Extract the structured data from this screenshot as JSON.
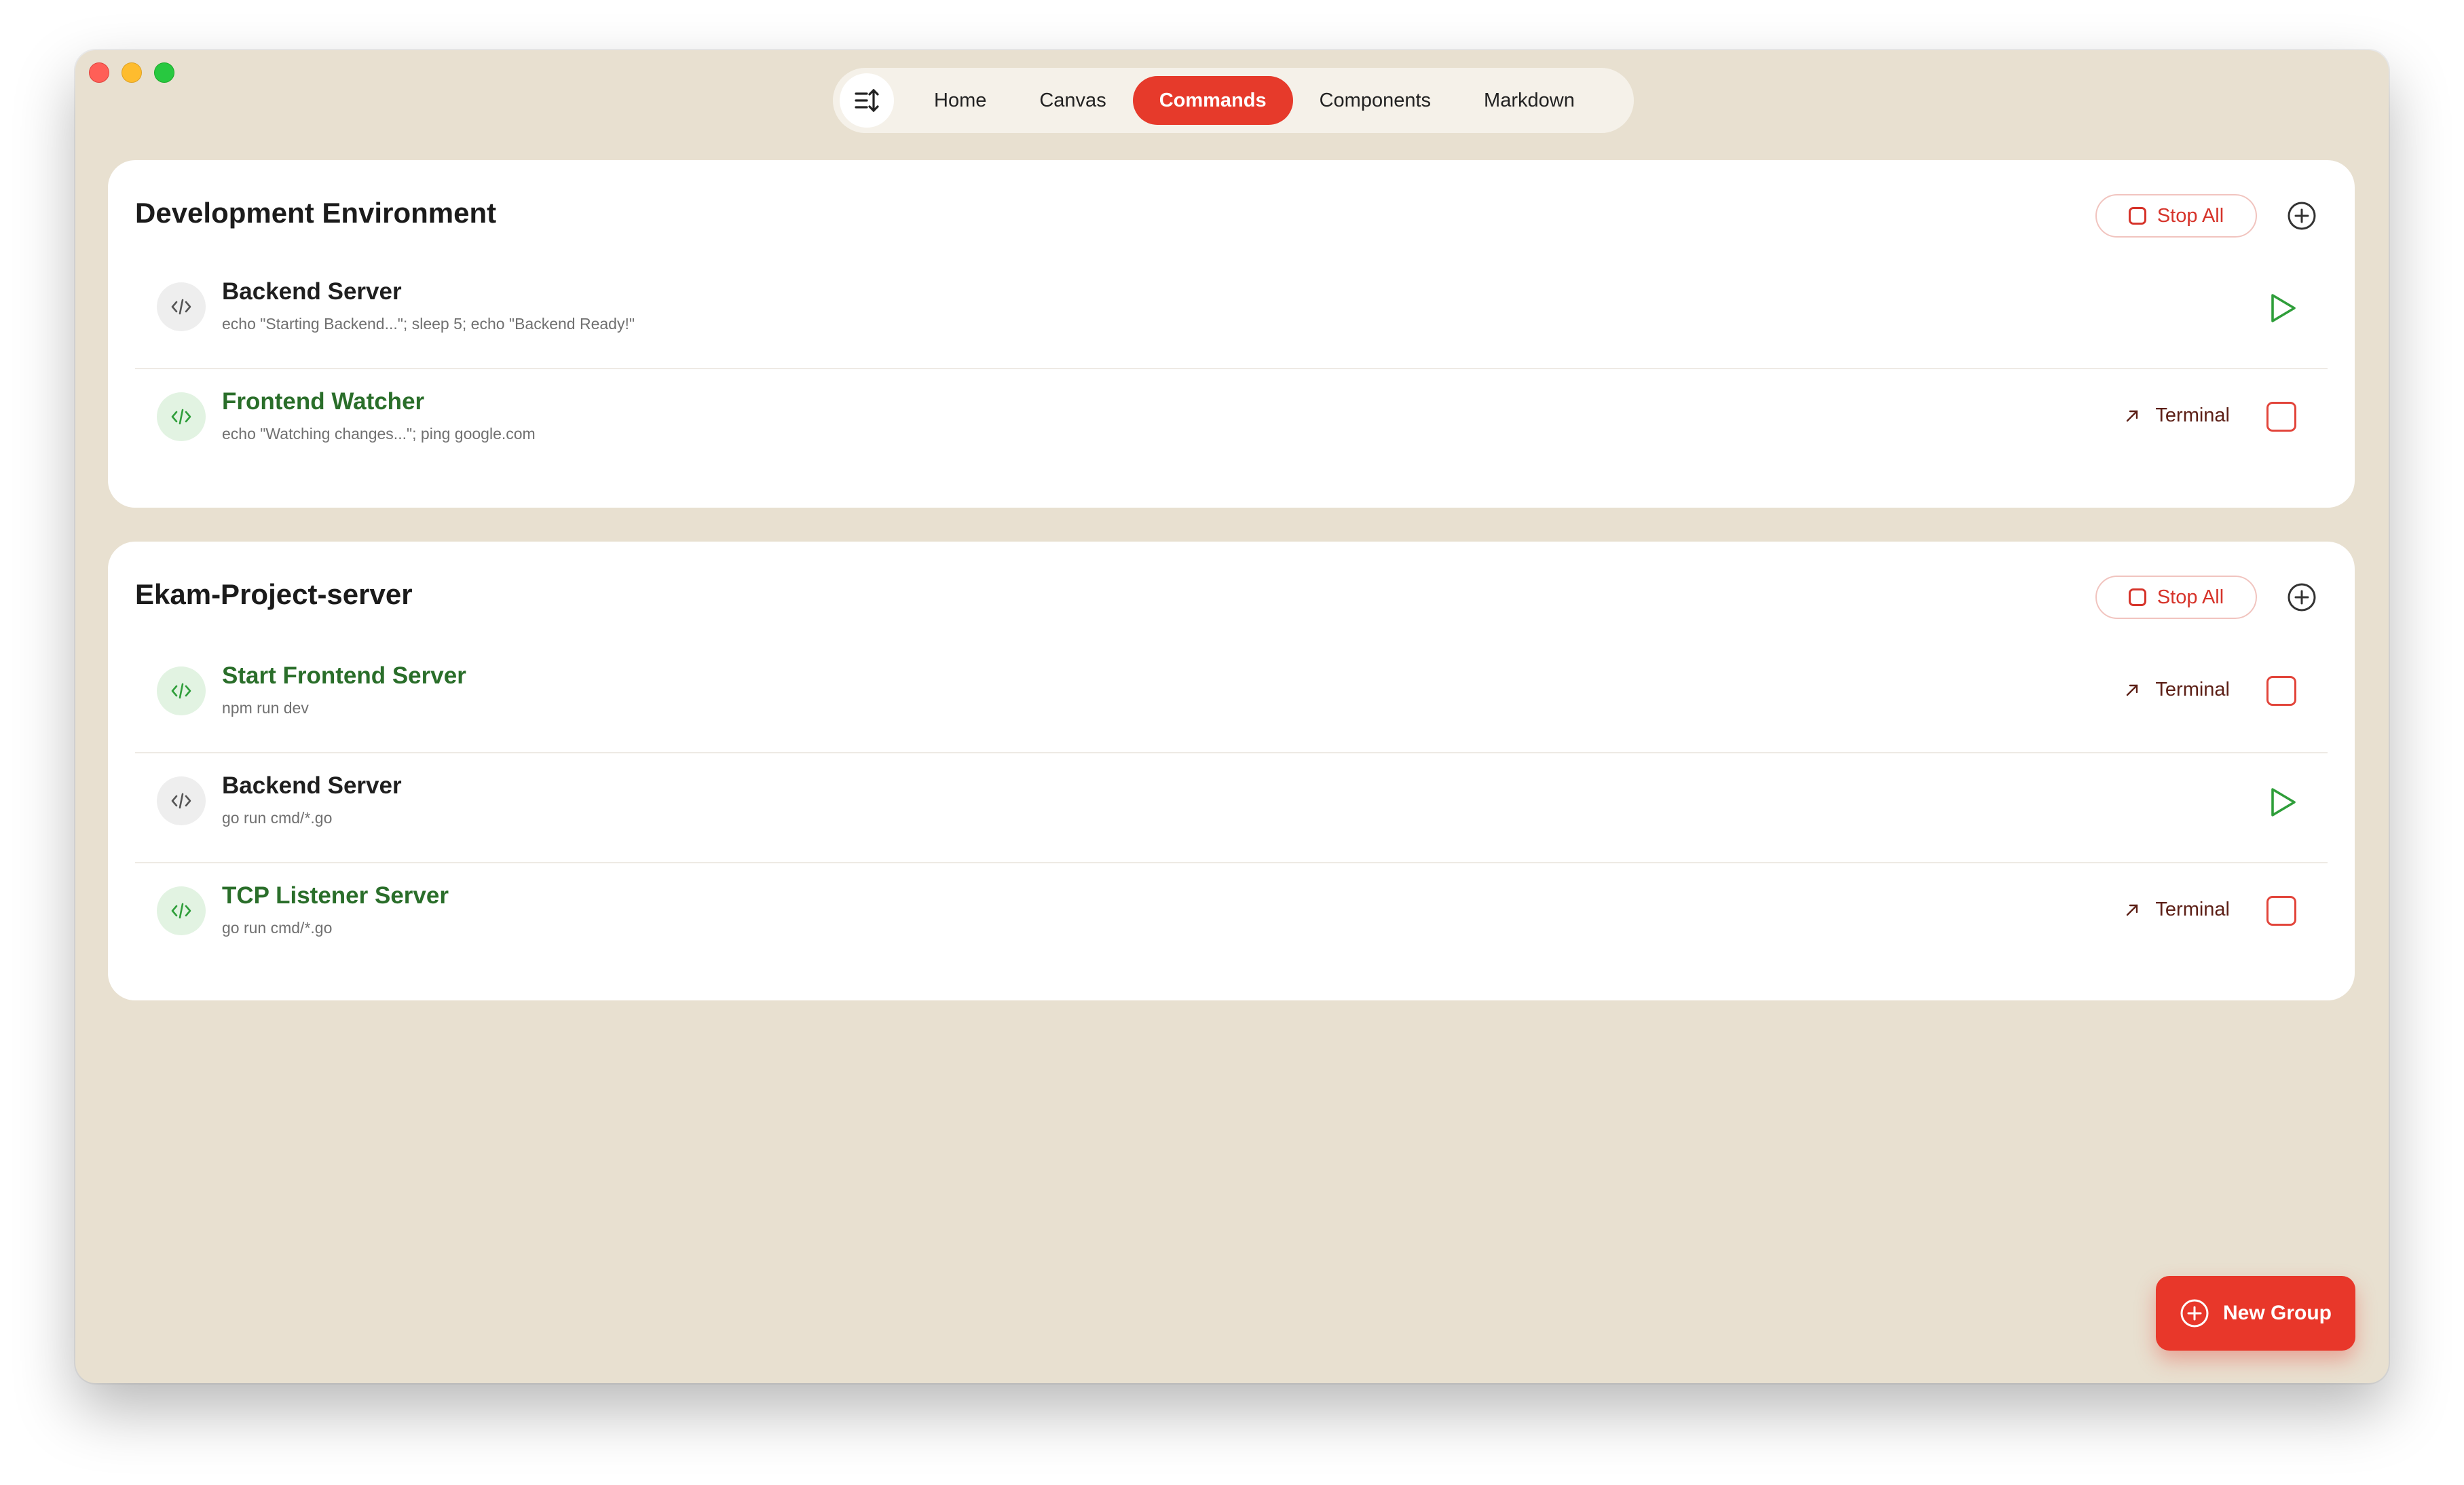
{
  "nav": {
    "tabs": [
      {
        "label": "Home",
        "active": false
      },
      {
        "label": "Canvas",
        "active": false
      },
      {
        "label": "Commands",
        "active": true
      },
      {
        "label": "Components",
        "active": false
      },
      {
        "label": "Markdown",
        "active": false
      }
    ]
  },
  "groups": [
    {
      "title": "Development Environment",
      "stop_all_label": "Stop All",
      "commands": [
        {
          "name": "Backend Server",
          "command": "echo \"Starting Backend...\"; sleep 5; echo \"Backend Ready!\"",
          "status": "idle"
        },
        {
          "name": "Frontend Watcher",
          "command": "echo \"Watching changes...\"; ping google.com",
          "status": "running",
          "terminal_label": "Terminal"
        }
      ]
    },
    {
      "title": "Ekam-Project-server",
      "stop_all_label": "Stop All",
      "commands": [
        {
          "name": "Start Frontend Server",
          "command": "npm run dev",
          "status": "running",
          "terminal_label": "Terminal"
        },
        {
          "name": "Backend Server",
          "command": "go run cmd/*.go",
          "status": "idle"
        },
        {
          "name": "TCP Listener Server",
          "command": "go run cmd/*.go",
          "status": "running",
          "terminal_label": "Terminal"
        }
      ]
    }
  ],
  "new_group_label": "New Group",
  "colors": {
    "accent": "#e63a2b",
    "running": "#2a6e2a",
    "background": "#e8e0d0"
  }
}
